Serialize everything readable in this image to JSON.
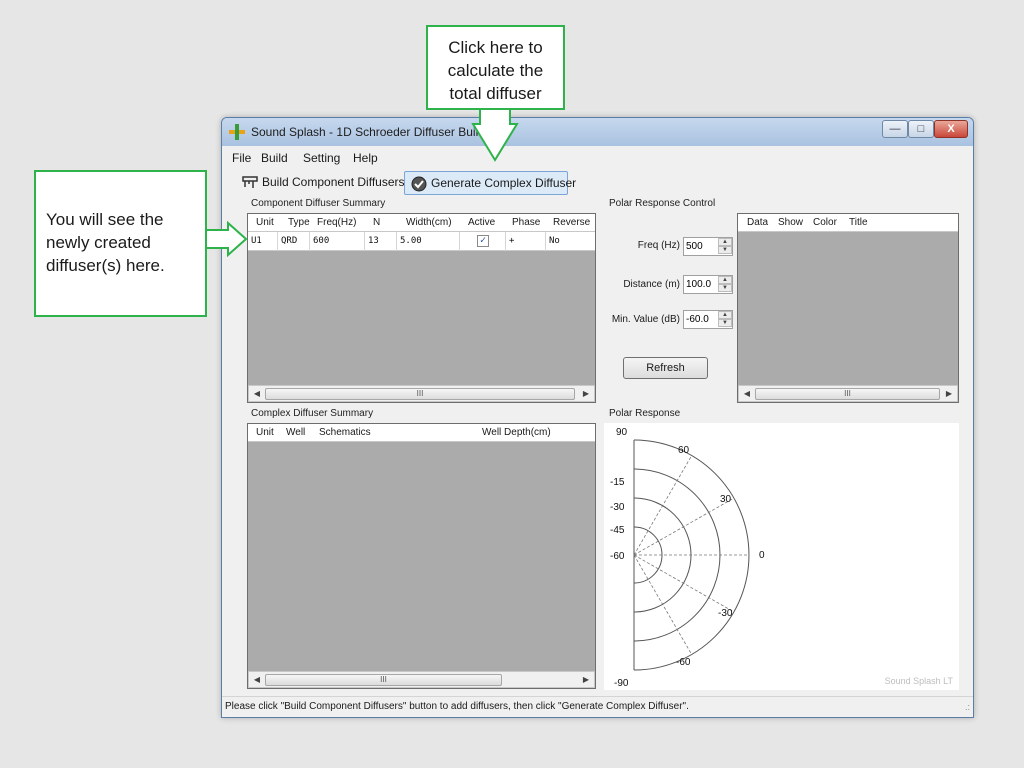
{
  "callouts": {
    "top": [
      "Click here to",
      "calculate the",
      "total diffuser"
    ],
    "left": [
      "You will see the",
      "newly created",
      "diffuser(s) here."
    ],
    "color": "#2db34a"
  },
  "window": {
    "title": "Sound Splash - 1D Schroeder Diffuser Builder",
    "icon": "app-plus-icon",
    "controls": {
      "minimize": "—",
      "maximize": "□",
      "close": "X"
    }
  },
  "menu": [
    "File",
    "Build",
    "Setting",
    "Help"
  ],
  "toolbar": {
    "build_label": "Build Component Diffusers",
    "generate_label": "Generate Complex Diffuser"
  },
  "component_summary": {
    "title": "Component Diffuser Summary",
    "columns": [
      "Unit",
      "Type",
      "Freq(Hz)",
      "N",
      "Width(cm)",
      "Active",
      "Phase",
      "Reverse"
    ],
    "rows": [
      {
        "unit": "U1",
        "type": "QRD",
        "freq": "600",
        "n": "13",
        "width": "5.00",
        "active": true,
        "phase": "+",
        "reverse": "No"
      }
    ],
    "scroll_thumb": "III"
  },
  "polar_control": {
    "title": "Polar Response Control",
    "freq_label": "Freq (Hz)",
    "freq_value": "500",
    "distance_label": "Distance (m)",
    "distance_value": "100.0",
    "min_label": "Min. Value (dB)",
    "min_value": "-60.0",
    "refresh_label": "Refresh",
    "list_columns": [
      "Data",
      "Show",
      "Color",
      "Title"
    ],
    "scroll_thumb": "III"
  },
  "complex_summary": {
    "title": "Complex Diffuser Summary",
    "columns": [
      "Unit",
      "Well",
      "Schematics",
      "Well Depth(cm)"
    ],
    "scroll_thumb": "III"
  },
  "polar_response": {
    "title": "Polar Response",
    "angle_labels": [
      "90",
      "60",
      "30",
      "0",
      "-30",
      "-60",
      "-90"
    ],
    "radial_labels": [
      "-15",
      "-30",
      "-45",
      "-60"
    ],
    "watermark": "Sound Splash LT"
  },
  "status": "Please click \"Build Component Diffusers\" button to add diffusers, then click \"Generate Complex Diffuser\"."
}
